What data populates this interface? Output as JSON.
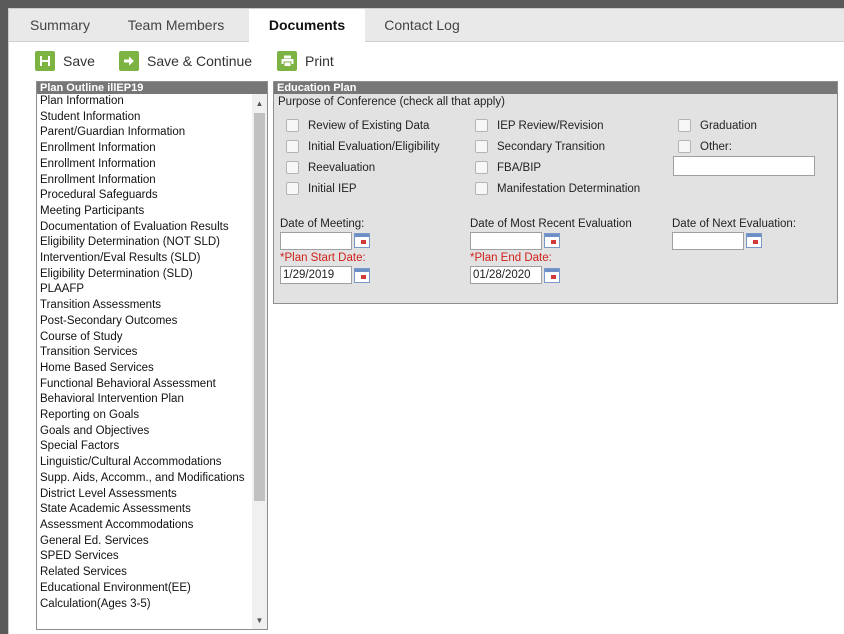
{
  "tabs": [
    "Summary",
    "Team Members",
    "Documents",
    "Contact Log"
  ],
  "active_tab": "Documents",
  "toolbar": {
    "save": "Save",
    "save_continue": "Save & Continue",
    "print": "Print"
  },
  "outline": {
    "title": "Plan Outline illEP19",
    "items": [
      "Plan Information",
      "Student Information",
      "Parent/Guardian Information",
      "Enrollment Information",
      "Enrollment Information",
      "Enrollment Information",
      "Procedural Safeguards",
      "Meeting Participants",
      "Documentation of Evaluation Results",
      "Eligibility Determination (NOT SLD)",
      "Intervention/Eval Results (SLD)",
      "Eligibility Determination (SLD)",
      "PLAAFP",
      "Transition Assessments",
      "Post-Secondary Outcomes",
      "Course of Study",
      "Transition Services",
      "Home Based Services",
      "Functional Behavioral Assessment",
      "Behavioral Intervention Plan",
      "Reporting on Goals",
      "Goals and Objectives",
      "Special Factors",
      "Linguistic/Cultural Accommodations",
      "Supp. Aids, Accomm., and Modifications",
      "District Level Assessments",
      "State Academic Assessments",
      "Assessment Accommodations",
      "General Ed. Services",
      "SPED Services",
      "Related Services",
      "Educational Environment(EE)",
      "Calculation(Ages 3-5)"
    ]
  },
  "education_plan": {
    "title": "Education Plan",
    "purpose_label": "Purpose of Conference (check all that apply)",
    "checkboxes": {
      "review_existing": "Review of Existing Data",
      "initial_eval": "Initial Evaluation/Eligibility",
      "reevaluation": "Reevaluation",
      "initial_iep": "Initial IEP",
      "iep_review": "IEP Review/Revision",
      "secondary_transition": "Secondary Transition",
      "fba_bip": "FBA/BIP",
      "manifestation": "Manifestation Determination",
      "graduation": "Graduation",
      "other": "Other:"
    },
    "other_value": "",
    "date_of_meeting_label": "Date of Meeting:",
    "date_of_meeting": "",
    "recent_eval_label": "Date of Most Recent Evaluation",
    "recent_eval": "",
    "next_eval_label": "Date of Next Evaluation:",
    "next_eval": "",
    "plan_start_label": "*Plan Start Date:",
    "plan_start": "1/29/2019",
    "plan_end_label": "*Plan End Date:",
    "plan_end": "01/28/2020"
  },
  "colors": {
    "accent_green": "#7cb342",
    "required_red": "#d0211b",
    "header_gray": "#777777"
  }
}
